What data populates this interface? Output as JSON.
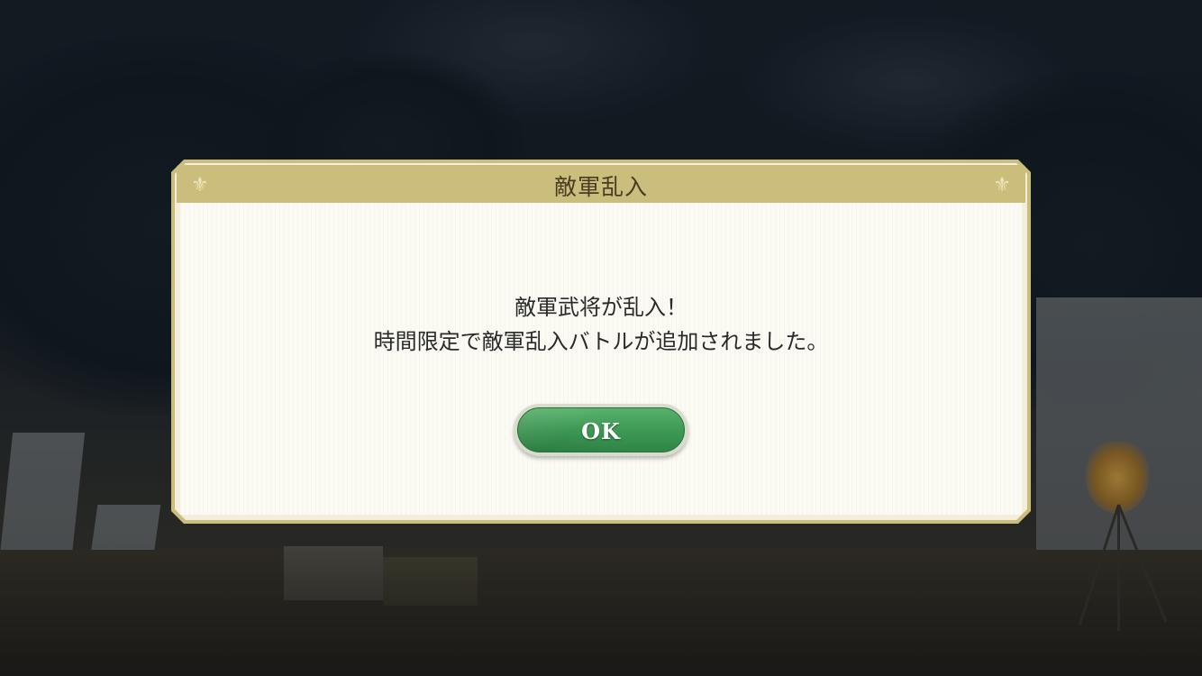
{
  "dialog": {
    "title": "敵軍乱入",
    "message_line1": "敵軍武将が乱入！",
    "message_line2": "時間限定で敵軍乱入バトルが追加されました。",
    "ok_label": "OK",
    "corner_ornament_icon": "fleur-de-lis-icon"
  },
  "colors": {
    "frame_gold": "#cbbd7c",
    "content_background": "#fbfaf3",
    "button_green": "#3e9a55",
    "title_text": "#4a3c22"
  }
}
